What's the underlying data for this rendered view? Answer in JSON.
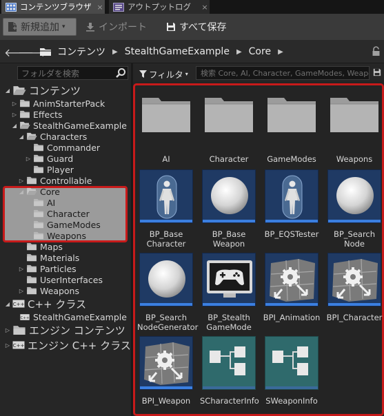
{
  "tabs": [
    {
      "label": "コンテンツブラウザ",
      "icon": "content-browser-icon",
      "close": "×",
      "active": true
    },
    {
      "label": "アウトプットログ",
      "icon": "output-log-icon",
      "close": "×",
      "active": false
    }
  ],
  "toolbar": {
    "new_label": "新規追加",
    "new_caret": "▾",
    "import_label": "インポート",
    "saveall_label": "すべて保存"
  },
  "nav": {
    "back": "🡐",
    "forward": "🡒",
    "breadcrumbs": [
      "コンテンツ",
      "StealthGameExample",
      "Core"
    ],
    "sep": "▶"
  },
  "sidebar": {
    "search_placeholder": "フォルダを検索",
    "tree": [
      {
        "label": "コンテンツ",
        "exp": "◢",
        "kind": "root",
        "depth": 0
      },
      {
        "label": "AnimStarterPack",
        "exp": "▷",
        "depth": 1
      },
      {
        "label": "Effects",
        "exp": "▷",
        "depth": 1
      },
      {
        "label": "StealthGameExample",
        "exp": "◢",
        "depth": 1
      },
      {
        "label": "Characters",
        "exp": "◢",
        "depth": 2
      },
      {
        "label": "Commander",
        "exp": "",
        "depth": 3
      },
      {
        "label": "Guard",
        "exp": "▷",
        "depth": 3
      },
      {
        "label": "Player",
        "exp": "",
        "depth": 3
      },
      {
        "label": "Controllable",
        "exp": "▷",
        "depth": 2
      },
      {
        "label": "Core",
        "exp": "◢",
        "depth": 2,
        "selected": true
      },
      {
        "label": "AI",
        "exp": "",
        "depth": 3,
        "selected": true
      },
      {
        "label": "Character",
        "exp": "",
        "depth": 3,
        "selected": true
      },
      {
        "label": "GameModes",
        "exp": "",
        "depth": 3,
        "selected": true
      },
      {
        "label": "Weapons",
        "exp": "",
        "depth": 3,
        "selected": true
      },
      {
        "label": "Maps",
        "exp": "",
        "depth": 2
      },
      {
        "label": "Materials",
        "exp": "",
        "depth": 2
      },
      {
        "label": "Particles",
        "exp": "▷",
        "depth": 2
      },
      {
        "label": "UserInterfaces",
        "exp": "",
        "depth": 2
      },
      {
        "label": "Weapons",
        "exp": "▷",
        "depth": 2
      },
      {
        "label": "C++ クラス",
        "exp": "◢",
        "kind": "cpp-root",
        "depth": 0
      },
      {
        "label": "StealthGameExample",
        "exp": "",
        "kind": "cpp",
        "depth": 1
      },
      {
        "label": "エンジン コンテンツ",
        "exp": "▷",
        "kind": "root",
        "depth": 0
      },
      {
        "label": "エンジン C++ クラス",
        "exp": "▷",
        "kind": "cpp-root",
        "depth": 0
      }
    ]
  },
  "assets": {
    "filter_label": "フィルタ",
    "filter_caret": "▾",
    "search_placeholder": "検索 Core, AI, Character, GameModes, Weapons",
    "items": [
      {
        "name": "AI",
        "kind": "folder"
      },
      {
        "name": "Character",
        "kind": "folder"
      },
      {
        "name": "GameModes",
        "kind": "folder"
      },
      {
        "name": "Weapons",
        "kind": "folder"
      },
      {
        "name": "BP_Base Character",
        "kind": "mannequin"
      },
      {
        "name": "BP_Base Weapon",
        "kind": "sphere"
      },
      {
        "name": "BP_EQSTester",
        "kind": "mannequin"
      },
      {
        "name": "BP_Search Node",
        "kind": "sphere"
      },
      {
        "name": "BP_Search NodeGenerator",
        "kind": "sphere"
      },
      {
        "name": "BP_Stealth GameMode",
        "kind": "gamemode"
      },
      {
        "name": "BPI_Animation",
        "kind": "interface"
      },
      {
        "name": "BPI_Character",
        "kind": "interface"
      },
      {
        "name": "BPI_Weapon",
        "kind": "interface"
      },
      {
        "name": "SCharacterInfo",
        "kind": "struct"
      },
      {
        "name": "SWeaponInfo",
        "kind": "struct"
      }
    ]
  },
  "colors": {
    "highlight_border": "#c81a1a",
    "folder": "#b8b8b8",
    "asset_bg": "#1f3a64",
    "struct_bg": "#2f6a6c",
    "accent_stripe": "#3b7fe0"
  }
}
